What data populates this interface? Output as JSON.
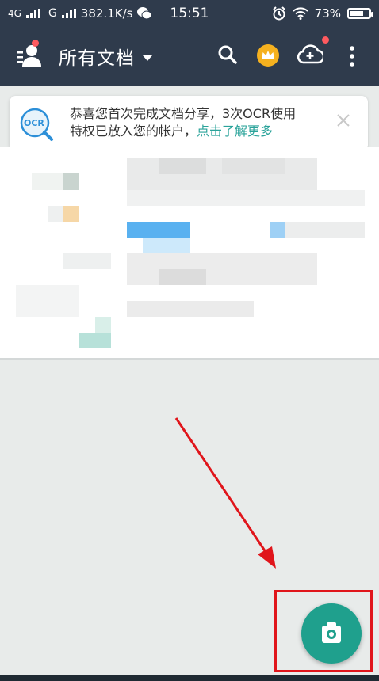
{
  "status_bar": {
    "network_1": "4G",
    "network_2": "G",
    "speed": "382.1K/s",
    "time": "15:51",
    "battery": "73%",
    "battery_level": 0.73
  },
  "app_bar": {
    "title": "所有文档",
    "icons": [
      "user-menu-icon",
      "search-icon",
      "crown-vip-icon",
      "cloud-add-icon",
      "more-vertical-icon"
    ],
    "notification_color": "#ff5a5f",
    "background_color": "#2f3b4c"
  },
  "banner": {
    "badge_text": "OCR",
    "message_line1": "恭喜您首次完成文档分享，3次OCR使用",
    "message_line2": "特权已放入您的帐户，",
    "link_text": "点击了解更多",
    "accent_color": "#2aa39a"
  },
  "fab": {
    "icon": "camera-icon",
    "color": "#1fa08d"
  },
  "annotation": {
    "arrow_color": "#e0151b",
    "highlight_color": "#e0151b"
  }
}
